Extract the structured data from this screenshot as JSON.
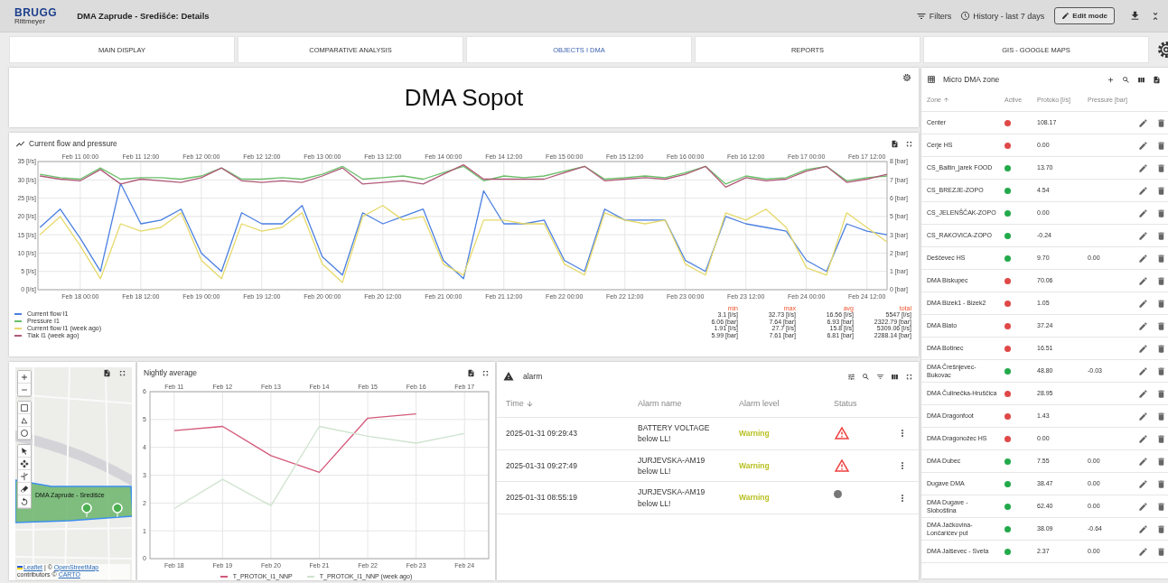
{
  "header": {
    "logo_top": "BRUGG",
    "logo_bottom": "Rittmeyer",
    "title": "DMA Zaprude - Središće: Details",
    "filters": "Filters",
    "history": "History - last 7 days",
    "edit_mode": "Edit mode"
  },
  "tabs": [
    {
      "label": "MAIN DISPLAY",
      "selected": false
    },
    {
      "label": "COMPARATIVE ANALYSIS",
      "selected": false
    },
    {
      "label": "OBJECTS I DMA",
      "selected": true
    },
    {
      "label": "REPORTS",
      "selected": false
    },
    {
      "label": "GIS - GOOGLE MAPS",
      "selected": false
    }
  ],
  "title_card": {
    "title": "DMA Sopot"
  },
  "flow_chart": {
    "title": "Current flow and pressure",
    "top_axis": [
      "Feb 11 00:00",
      "Feb 11 12:00",
      "Feb 12 00:00",
      "Feb 12 12:00",
      "Feb 13 00:00",
      "Feb 13 12:00",
      "Feb 14 00:00",
      "Feb 14 12:00",
      "Feb 15 00:00",
      "Feb 15 12:00",
      "Feb 16 00:00",
      "Feb 16 12:00",
      "Feb 17 00:00",
      "Feb 17 12:00"
    ],
    "chart_data": {
      "type": "line",
      "grid": true,
      "ylim": [
        0,
        35
      ],
      "y2lim": [
        0,
        8
      ],
      "categories": [
        null,
        null,
        "Feb 18 00:00",
        null,
        null,
        "Feb 18 12:00",
        null,
        null,
        "Feb 19 00:00",
        null,
        null,
        "Feb 19 12:00",
        null,
        null,
        "Feb 20 00:00",
        null,
        null,
        "Feb 20 12:00",
        null,
        null,
        "Feb 21 00:00",
        null,
        null,
        "Feb 21 12:00",
        null,
        null,
        "Feb 22 00:00",
        null,
        null,
        "Feb 22 12:00",
        null,
        null,
        "Feb 23 00:00",
        null,
        null,
        "Feb 23 12:00",
        null,
        null,
        "Feb 24 00:00",
        null,
        null,
        "Feb 24 12:00",
        null
      ],
      "yticks": [
        {
          "value": 0,
          "label": "0 [l/s]"
        },
        {
          "value": 5,
          "label": "5 [l/s]"
        },
        {
          "value": 10,
          "label": "10 [l/s]"
        },
        {
          "value": 15,
          "label": "15 [l/s]"
        },
        {
          "value": 20,
          "label": "20 [l/s]"
        },
        {
          "value": 25,
          "label": "25 [l/s]"
        },
        {
          "value": 30,
          "label": "30 [l/s]"
        },
        {
          "value": 35,
          "label": "35 [l/s]"
        }
      ],
      "y2ticks": [
        {
          "value": 0,
          "label": "0 [bar]"
        },
        {
          "value": 1.143,
          "label": "1 [bar]"
        },
        {
          "value": 2.286,
          "label": "2 [bar]"
        },
        {
          "value": 3.429,
          "label": "3 [bar]"
        },
        {
          "value": 4.571,
          "label": "5 [bar]"
        },
        {
          "value": 5.714,
          "label": "6 [bar]"
        },
        {
          "value": 6.857,
          "label": "7 [bar]"
        },
        {
          "value": 8,
          "label": "8 [bar]"
        }
      ],
      "series": [
        {
          "name": "Current flow I1",
          "color": "#4a7fe0",
          "values": [
            17,
            22,
            14,
            5,
            29,
            18,
            19,
            22,
            10,
            5,
            21,
            18,
            18,
            23,
            9,
            4,
            21,
            18,
            20,
            22,
            8,
            3,
            27,
            18,
            18,
            19,
            8,
            5,
            22,
            19,
            19,
            19,
            8,
            5,
            20,
            18,
            17,
            16,
            8,
            5,
            18,
            16,
            15
          ]
        },
        {
          "name": "Pressure I1",
          "color": "#6abf69",
          "axis": "y2",
          "values": [
            7.2,
            7.0,
            6.9,
            7.6,
            6.9,
            7.0,
            7.0,
            6.9,
            7.1,
            7.6,
            6.9,
            6.9,
            7.0,
            6.9,
            7.2,
            7.7,
            6.9,
            7.0,
            7.1,
            6.9,
            7.3,
            7.7,
            6.8,
            7.1,
            7.0,
            7.1,
            7.4,
            7.7,
            6.9,
            7.0,
            7.1,
            7.0,
            7.3,
            7.7,
            6.6,
            7.1,
            6.9,
            7.0,
            7.5,
            7.7,
            6.8,
            7.0,
            7.1
          ]
        },
        {
          "name": "Current flow I1 (week ago)",
          "color": "#e6d96a",
          "values": [
            15,
            20,
            12,
            3,
            18,
            16,
            17,
            21,
            8,
            3,
            18,
            16,
            17,
            21,
            7,
            2,
            20,
            23,
            19,
            20,
            7,
            4,
            19,
            19,
            18,
            18,
            7,
            4,
            21,
            19,
            18,
            19,
            7,
            4,
            21,
            19,
            22,
            17,
            6,
            4,
            21,
            17,
            13
          ]
        },
        {
          "name": "Tlak I1 (week ago)",
          "color": "#b05a78",
          "axis": "y2",
          "values": [
            7.1,
            6.9,
            6.8,
            7.5,
            6.6,
            6.9,
            6.8,
            6.7,
            7.0,
            7.6,
            6.8,
            6.7,
            6.8,
            6.7,
            7.1,
            7.6,
            6.6,
            6.7,
            6.8,
            6.6,
            7.2,
            7.8,
            6.9,
            6.9,
            6.9,
            6.9,
            7.3,
            7.7,
            6.8,
            6.9,
            7.0,
            6.9,
            7.2,
            7.7,
            6.4,
            7.0,
            6.8,
            6.9,
            7.4,
            7.7,
            6.7,
            6.9,
            7.2
          ]
        }
      ]
    },
    "stats": {
      "columns": [
        "min",
        "max",
        "avg",
        "total"
      ],
      "rows": [
        [
          "3.1 [l/s]",
          "32.73 [l/s]",
          "16.56 [l/s]",
          "5547 [l/s]"
        ],
        [
          "6.06 [bar]",
          "7.64 [bar]",
          "6.93 [bar]",
          "2322.79 [bar]"
        ],
        [
          "1.91 [l/s]",
          "27.7 [l/s]",
          "15.8 [l/s]",
          "5309.06 [l/s]"
        ],
        [
          "5.99 [bar]",
          "7.61 [bar]",
          "6.81 [bar]",
          "2288.14 [bar]"
        ]
      ]
    }
  },
  "map": {
    "label": "DMA Zaprude - Središće",
    "attribution": [
      {
        "text": "Leaflet",
        "link": true
      },
      {
        "text": " | © ",
        "link": false
      },
      {
        "text": "OpenStreetMap",
        "link": true
      },
      {
        "text": " contributors © ",
        "link": false
      },
      {
        "text": "CARTO",
        "link": true
      }
    ]
  },
  "nightly_chart": {
    "title": "Nightly average",
    "top_axis": [
      "Feb 11",
      "Feb 12",
      "Feb 13",
      "Feb 14",
      "Feb 15",
      "Feb 16",
      "Feb 17"
    ],
    "chart_data": {
      "type": "line",
      "grid": true,
      "categories": [
        "Feb 18",
        "Feb 19",
        "Feb 20",
        "Feb 21",
        "Feb 22",
        "Feb 23",
        "Feb 24"
      ],
      "ylim": [
        0,
        6
      ],
      "yticks": [
        0,
        1,
        2,
        3,
        4,
        5,
        6
      ],
      "series": [
        {
          "name": "T_PROTOK_I1_NNP",
          "color": "#d4587a",
          "values": [
            4.6,
            4.75,
            3.7,
            3.1,
            5.05,
            5.2,
            null
          ]
        },
        {
          "name": "T_PROTOK_I1_NNP (week ago)",
          "color": "#cfe3cf",
          "values": [
            1.8,
            2.85,
            1.9,
            4.75,
            4.4,
            4.15,
            4.5
          ]
        }
      ]
    }
  },
  "alarm": {
    "title": "alarm",
    "columns": [
      "Time",
      "Alarm name",
      "Alarm level",
      "Status"
    ],
    "rows": [
      {
        "time": "2025-01-31 09:29:43",
        "name": "BATTERY VOLTAGE below LL!",
        "level": "Warning",
        "kind": "warning"
      },
      {
        "time": "2025-01-31 09:27:49",
        "name": "JURJEVSKA-AM19 below LL!",
        "level": "Warning",
        "kind": "warning"
      },
      {
        "time": "2025-01-31 08:55:19",
        "name": "JURJEVSKA-AM19 below LL!",
        "level": "Warning",
        "kind": "dot"
      }
    ]
  },
  "zones": {
    "title": "Micro DMA zone",
    "columns": [
      "Zone",
      "Active",
      "Protoko [l/s]",
      "Pressure [bar]"
    ],
    "rows": [
      {
        "zone": "Center",
        "active": false,
        "flow": "108.17"
      },
      {
        "zone": "Cerje HS",
        "active": false,
        "flow": "0.00"
      },
      {
        "zone": "CS_Baltin_jarek FOOD",
        "active": true,
        "flow": "13.70"
      },
      {
        "zone": "CS_BREZJE-ZOPO",
        "active": true,
        "flow": "4.54"
      },
      {
        "zone": "CS_JELENŠČAK-ZOPO",
        "active": true,
        "flow": "0.00"
      },
      {
        "zone": "CS_RAKOVICA-ZOPO",
        "active": true,
        "flow": "-0.24"
      },
      {
        "zone": "Deščevec HS",
        "active": true,
        "flow": "9.70",
        "pressure": "0.00"
      },
      {
        "zone": "DMA Biskupec",
        "active": false,
        "flow": "70.06"
      },
      {
        "zone": "DMA Bizek1 - Bizek2",
        "active": false,
        "flow": "1.05"
      },
      {
        "zone": "DMA Blato",
        "active": false,
        "flow": "37.24"
      },
      {
        "zone": "DMA Botinec",
        "active": false,
        "flow": "16.51"
      },
      {
        "zone": "DMA Črešnjevec-Bukovac",
        "active": true,
        "flow": "48.80",
        "pressure": "-0.03"
      },
      {
        "zone": "DMA Čulinečka-Hruščica",
        "active": false,
        "flow": "28.95"
      },
      {
        "zone": "DMA Dragonfoot",
        "active": false,
        "flow": "1.43"
      },
      {
        "zone": "DMA Dragonožec HS",
        "active": false,
        "flow": "0.00"
      },
      {
        "zone": "DMA Dubec",
        "active": true,
        "flow": "7.55",
        "pressure": "0.00"
      },
      {
        "zone": "Dugave DMA",
        "active": true,
        "flow": "38.47",
        "pressure": "0.00"
      },
      {
        "zone": "DMA Dugave - Sloboština",
        "active": true,
        "flow": "62.40",
        "pressure": "0.00"
      },
      {
        "zone": "DMA Jačkovina-Lončarićev put",
        "active": true,
        "flow": "38.09",
        "pressure": "-0.64"
      },
      {
        "zone": "DMA Jalševec - Sveta",
        "active": true,
        "flow": "2.37",
        "pressure": "0.00"
      }
    ]
  }
}
